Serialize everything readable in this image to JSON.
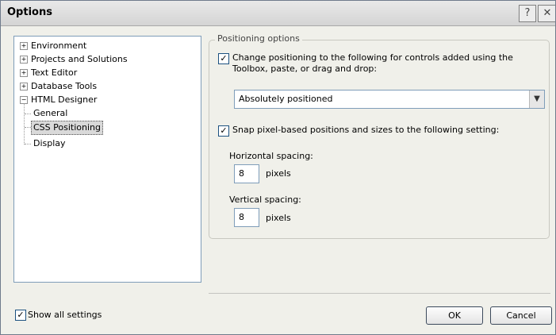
{
  "window": {
    "title": "Options",
    "help_glyph": "?",
    "close_glyph": "✕"
  },
  "tree": {
    "items": [
      {
        "label": "Environment",
        "expander": "+"
      },
      {
        "label": "Projects and Solutions",
        "expander": "+"
      },
      {
        "label": "Text Editor",
        "expander": "+"
      },
      {
        "label": "Database Tools",
        "expander": "+"
      },
      {
        "label": "HTML Designer",
        "expander": "−"
      },
      {
        "label": "General"
      },
      {
        "label": "CSS Positioning",
        "selected": true
      },
      {
        "label": "Display"
      }
    ]
  },
  "positioning": {
    "group_label": "Positioning options",
    "change_checkbox": {
      "checked": true,
      "check_glyph": "✓",
      "line1": "Change positioning to the following for controls added using the",
      "line2": "Toolbox, paste, or drag and drop:"
    },
    "mode_select": {
      "value": "Absolutely positioned",
      "arrow_glyph": "▼"
    },
    "snap_checkbox": {
      "checked": true,
      "check_glyph": "✓",
      "label": "Snap pixel-based positions and sizes to the following setting:"
    },
    "horizontal": {
      "label": "Horizontal spacing:",
      "value": "8",
      "unit": "pixels"
    },
    "vertical": {
      "label": "Vertical spacing:",
      "value": "8",
      "unit": "pixels"
    }
  },
  "footer": {
    "show_all": {
      "checked": true,
      "check_glyph": "✓",
      "label": "Show all settings"
    },
    "ok_label": "OK",
    "cancel_label": "Cancel"
  }
}
